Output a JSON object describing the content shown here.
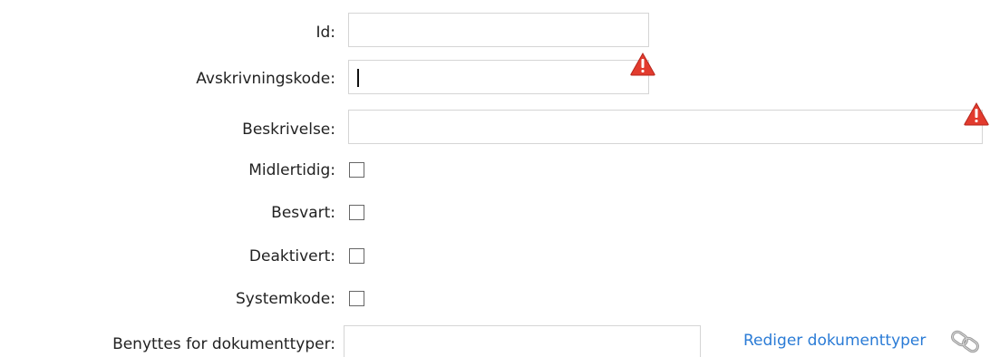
{
  "form": {
    "id": {
      "label": "Id:",
      "value": ""
    },
    "avskrivningskode": {
      "label": "Avskrivningskode:",
      "value": "",
      "warning_icon": "warning-triangle-icon"
    },
    "beskrivelse": {
      "label": "Beskrivelse:",
      "value": "",
      "warning_icon": "warning-triangle-icon"
    },
    "midlertidig": {
      "label": "Midlertidig:",
      "checked": false
    },
    "besvart": {
      "label": "Besvart:",
      "checked": false
    },
    "deaktivert": {
      "label": "Deaktivert:",
      "checked": false
    },
    "systemkode": {
      "label": "Systemkode:",
      "checked": false
    },
    "benyttes": {
      "label": "Benyttes for dokumenttyper:",
      "value": ""
    },
    "rediger_link": {
      "label": "Rediger dokumenttyper",
      "icon": "chain-link-icon"
    }
  },
  "colors": {
    "link": "#2a7bd6",
    "warning": "#e23b2e",
    "border": "#d5d5d5"
  }
}
